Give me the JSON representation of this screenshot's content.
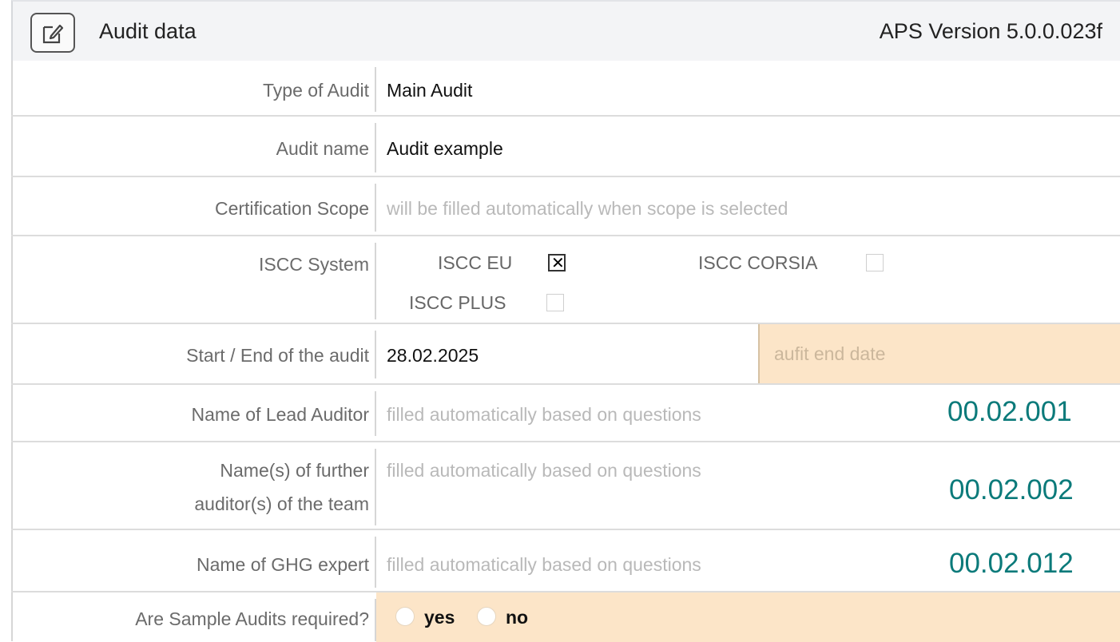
{
  "header": {
    "title": "Audit data",
    "version": "APS Version 5.0.0.023f",
    "edit_icon": "edit-icon"
  },
  "fields": {
    "type_of_audit": {
      "label": "Type of Audit",
      "value": "Main Audit"
    },
    "audit_name": {
      "label": "Audit name",
      "value": "Audit example"
    },
    "certification_scope": {
      "label": "Certification Scope",
      "placeholder": "will be filled automatically when scope is selected"
    },
    "iscc_system": {
      "label": "ISCC System",
      "options": [
        {
          "label": "ISCC EU",
          "checked": true
        },
        {
          "label": "ISCC CORSIA",
          "checked": false
        },
        {
          "label": "ISCC PLUS",
          "checked": false
        }
      ]
    },
    "start_end": {
      "label": "Start / End of the audit",
      "start_value": "28.02.2025",
      "end_placeholder": "aufit end date"
    },
    "lead_auditor": {
      "label": "Name of Lead Auditor",
      "placeholder": "filled automatically based on questions",
      "code": "00.02.001"
    },
    "further_auditors": {
      "label_line1": "Name(s) of further",
      "label_line2": "auditor(s) of the team",
      "placeholder": "filled automatically based on questions",
      "code": "00.02.002"
    },
    "ghg_expert": {
      "label": "Name of GHG expert",
      "placeholder": "filled automatically based on questions",
      "code": "00.02.012"
    },
    "sample_audits": {
      "label": "Are Sample Audits required?",
      "options": [
        "yes",
        "no"
      ]
    }
  },
  "colors": {
    "highlight_fill": "#fce5c8",
    "code_color": "#0b7a7a"
  }
}
